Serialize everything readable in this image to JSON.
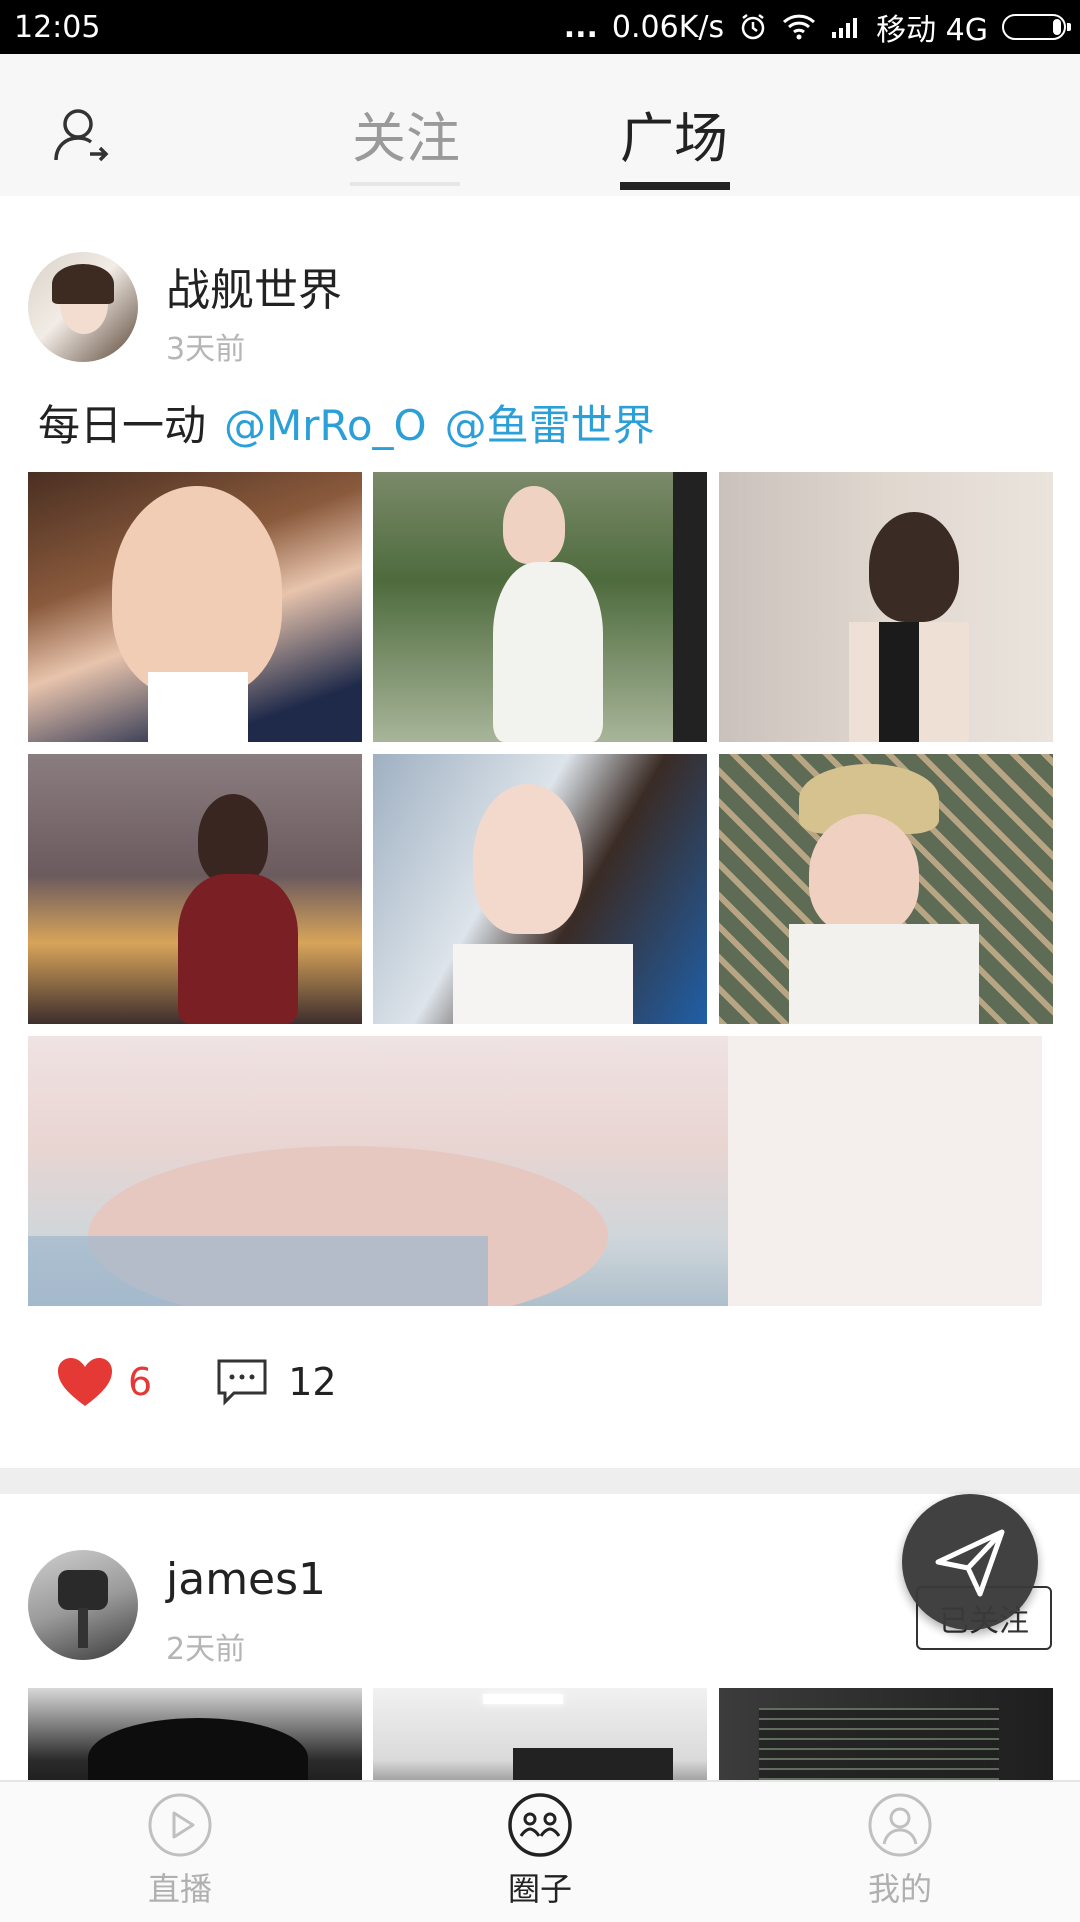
{
  "status_bar": {
    "time": "12:05",
    "dots": "...",
    "speed": "0.06K/s",
    "carrier": "移动 4G"
  },
  "header": {
    "tabs": [
      {
        "label": "关注",
        "active": false
      },
      {
        "label": "广场",
        "active": true
      }
    ]
  },
  "posts": [
    {
      "username": "战舰世界",
      "time": "3天前",
      "text": "每日一动",
      "mentions": [
        "@MrRo_O",
        "@鱼雷世界"
      ],
      "likes": "6",
      "comments": "12"
    },
    {
      "username": "james1",
      "time": "2天前",
      "follow_label": "已关注"
    }
  ],
  "bottom_nav": [
    {
      "label": "直播",
      "icon": "play-icon",
      "active": false
    },
    {
      "label": "圈子",
      "icon": "circle-face-icon",
      "active": true
    },
    {
      "label": "我的",
      "icon": "person-icon",
      "active": false
    }
  ],
  "colors": {
    "accent_mention": "#2a9fd8",
    "like_red": "#e53935",
    "header_bg": "#f7f7f7",
    "divider": "#eeeeee"
  }
}
